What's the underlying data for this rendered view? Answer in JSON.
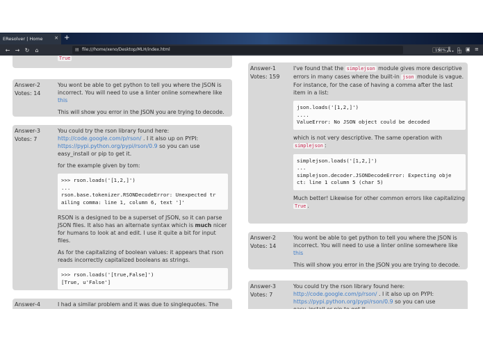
{
  "browser": {
    "tab_title": "EResolver | Home",
    "new_tab_glyph": "+",
    "url": "file:///home/xeno/Desktop/MLH/index.html",
    "zoom": "150%"
  },
  "left_column": {
    "top_fragment": "True",
    "answers": [
      {
        "label": "Answer-2",
        "votes": "Votes: 14",
        "p1_text": "You wont be able to get python to tell you where the JSON is incorrect. You will need to use a linter online somewhere like ",
        "p1_link": "this",
        "p2": "This will show you error in the JSON you are trying to decode."
      },
      {
        "label": "Answer-3",
        "votes": "Votes: 7",
        "p1_a": "You could try the rson library found here: ",
        "p1_link1": "http://code.google.com/p/rson/",
        "p1_b": " . I it also up on PYPI: ",
        "p1_link2": "https://pypi.python.org/pypi/rson/0.9",
        "p1_c": " so you can use easy_install or pip to get it.",
        "p2": "for the example given by tom:",
        "code1": ">>> rson.loads('[1,2,]')\n...\nrson.base.tokenizer.RSONDecodeError: Unexpected tr\nailing comma: line 1, column 6, text ']'",
        "p3_a": "RSON is a designed to be a superset of JSON, so it can parse JSON files. It also has an alternate syntax which is ",
        "p3_bold": "much",
        "p3_b": " nicer for humans to look at and edit. I use it quite a bit for input files.",
        "p4": "As for the capitalizing of boolean values: it appears that rson reads incorrectly capitalized booleans as strings.",
        "code2": ">>> rson.loads('[true,False]')\n[True, u'False']"
      },
      {
        "label": "Answer-4",
        "p1": "I had a similar problem and it was due to singlequotes. The JSON"
      }
    ]
  },
  "right_column": {
    "answers": [
      {
        "label": "Answer-1",
        "votes": "Votes: 159",
        "p1_a": "I've found that the ",
        "p1_code": "simplejson",
        "p1_b": " module gives more descriptive errors in many cases where the built-in ",
        "p1_code2": "json",
        "p1_c": " module is vague. For instance, for the case of having a comma after the last item in a list:",
        "code1": "json.loads('[1,2,]')\n....\nValueError: No JSON object could be decoded",
        "p2_a": "which is not very descriptive. The same operation with ",
        "p2_code": "simplejson",
        "p2_b": ":",
        "code2": "simplejson.loads('[1,2,]')\n...\nsimplejson.decoder.JSONDecodeError: Expecting obje\nct: line 1 column 5 (char 5)",
        "p3_a": "Much better! Likewise for other common errors like capitalizing ",
        "p3_code": "True",
        "p3_b": "."
      },
      {
        "label": "Answer-2",
        "votes": "Votes: 14",
        "p1_text": "You wont be able to get python to tell you where the JSON is incorrect. You will need to use a linter online somewhere like ",
        "p1_link": "this",
        "p2": "This will show you error in the JSON you are trying to decode."
      },
      {
        "label": "Answer-3",
        "votes": "Votes: 7",
        "p1_a": "You could try the rson library found here: ",
        "p1_link1": "http://code.google.com/p/rson/",
        "p1_b": " . I it also up on PYPI: ",
        "p1_link2": "https://pypi.python.org/pypi/rson/0.9",
        "p1_c": " so you can use easy_install or pip to get it."
      }
    ]
  },
  "icons": [
    "back-icon",
    "forward-icon",
    "reload-icon",
    "home-icon",
    "page-icon",
    "more-icon",
    "pocket-icon",
    "bookmark-star-icon",
    "download-icon",
    "library-icon",
    "sidebar-icon",
    "reader-icon",
    "menu-icon"
  ]
}
